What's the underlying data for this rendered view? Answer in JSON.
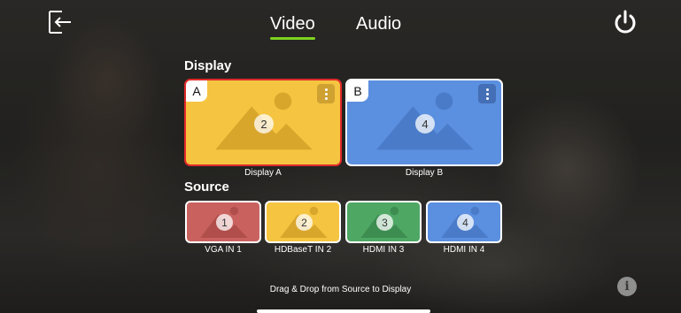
{
  "header": {
    "tabs": [
      {
        "label": "Video",
        "active": true
      },
      {
        "label": "Audio",
        "active": false
      }
    ],
    "accent_color": "#7ed321",
    "back_icon": "back-arrow-icon",
    "power_icon": "power-icon"
  },
  "display": {
    "title": "Display",
    "cards": [
      {
        "letter": "A",
        "source_number": "2",
        "caption": "Display A",
        "color": "#f5c440",
        "selected": true,
        "selected_border": "#e02a2a"
      },
      {
        "letter": "B",
        "source_number": "4",
        "caption": "Display B",
        "color": "#5b8fdf",
        "selected": false
      }
    ]
  },
  "source": {
    "title": "Source",
    "items": [
      {
        "number": "1",
        "label": "VGA IN 1",
        "color": "#c9625f"
      },
      {
        "number": "2",
        "label": "HDBaseT IN 2",
        "color": "#f5c440"
      },
      {
        "number": "3",
        "label": "HDMI IN 3",
        "color": "#4fa764"
      },
      {
        "number": "4",
        "label": "HDMI IN 4",
        "color": "#5b8fdf"
      }
    ]
  },
  "footer": {
    "hint": "Drag & Drop from Source to Display",
    "info_icon": "info-icon",
    "info_glyph": "i"
  }
}
